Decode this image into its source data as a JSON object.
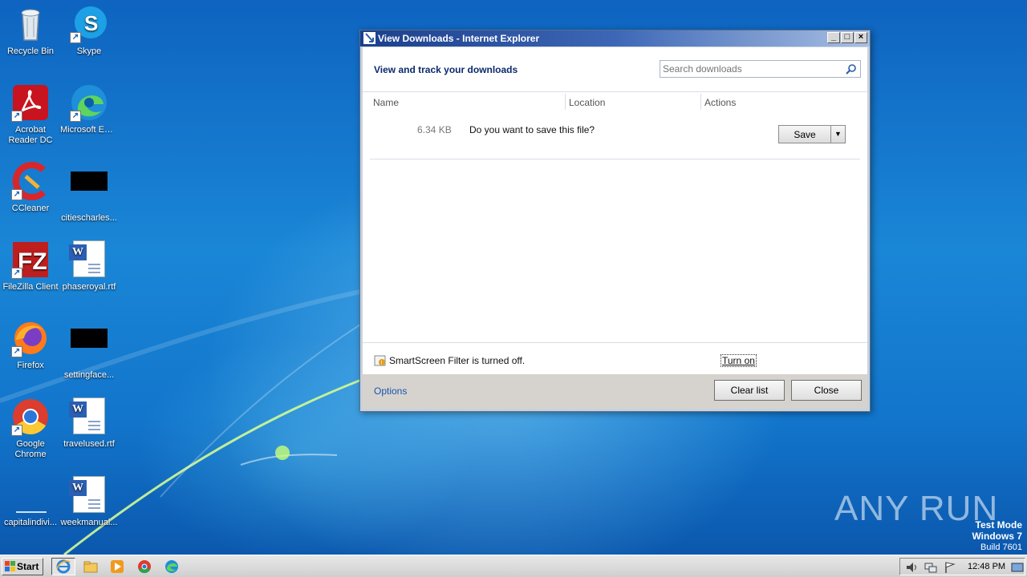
{
  "desktop": {
    "icons": [
      {
        "label": "Recycle Bin"
      },
      {
        "label": "Skype"
      },
      {
        "label": "Acrobat Reader DC"
      },
      {
        "label": "Microsoft Edge"
      },
      {
        "label": "CCleaner"
      },
      {
        "label": "citiescharles..."
      },
      {
        "label": "FileZilla Client"
      },
      {
        "label": "phaseroyal.rtf"
      },
      {
        "label": "Firefox"
      },
      {
        "label": "settingface..."
      },
      {
        "label": "Google Chrome"
      },
      {
        "label": "travelused.rtf"
      },
      {
        "label": "capitalindivi..."
      },
      {
        "label": "weekmanual..."
      }
    ]
  },
  "window": {
    "title": "View Downloads - Internet Explorer",
    "header": "View and track your downloads",
    "search_placeholder": "Search downloads",
    "columns": [
      "Name",
      "Location",
      "Actions"
    ],
    "download": {
      "size": "6.34 KB",
      "message": "Do you want to save this file?",
      "save_label": "Save"
    },
    "smartscreen": {
      "text": "SmartScreen Filter is turned off.",
      "turn_on": "Turn on"
    },
    "footer": {
      "options": "Options",
      "clear_list": "Clear list",
      "close": "Close"
    }
  },
  "watermark": {
    "brand": "ANY RUN",
    "line1": "Test Mode",
    "line2": "Windows 7",
    "line3": "Build 7601"
  },
  "taskbar": {
    "start": "Start",
    "clock": "12:48 PM",
    "apps": [
      "internet-explorer",
      "windows-explorer",
      "media-player",
      "chrome",
      "edge"
    ]
  }
}
